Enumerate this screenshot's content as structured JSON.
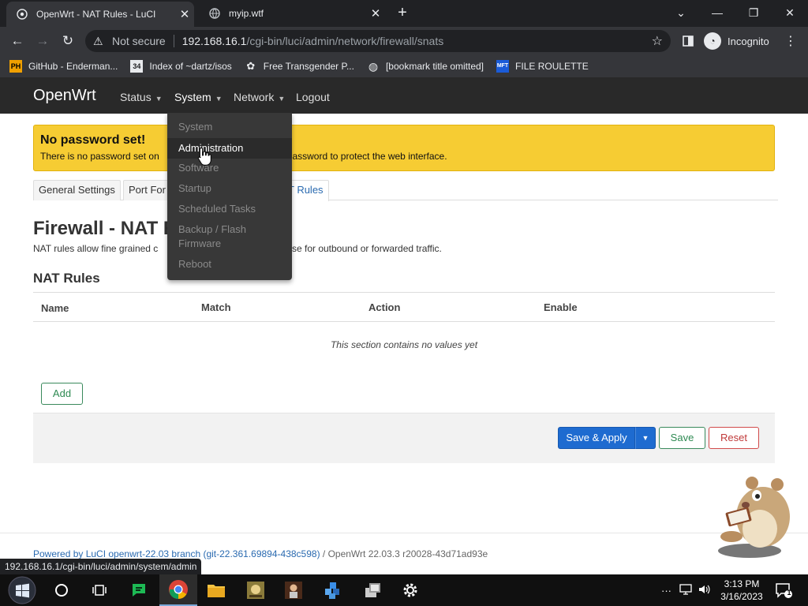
{
  "browser": {
    "tabs": [
      {
        "title": "OpenWrt - NAT Rules - LuCI",
        "active": true
      },
      {
        "title": "myip.wtf",
        "active": false
      }
    ],
    "new_tab_icon": "plus-icon",
    "window_controls": {
      "minimize": "chevron-down",
      "restore": "restore",
      "close": "close"
    },
    "nav": {
      "back": "←",
      "forward": "→",
      "reload": "↻"
    },
    "url": {
      "security_label": "Not secure",
      "host": "192.168.16.1",
      "path": "/cgi-bin/luci/admin/network/firewall/snats"
    },
    "incognito_label": "Incognito",
    "bookmarks": [
      {
        "icon": "PH",
        "label": "GitHub - Enderman..."
      },
      {
        "icon": "34",
        "label": "Index of ~dartz/isos"
      },
      {
        "icon": "✿",
        "label": "Free Transgender P..."
      },
      {
        "icon": "◍",
        "label": "[bookmark title omitted]"
      },
      {
        "icon": "MFT",
        "label": "FILE ROULETTE"
      }
    ],
    "status_url": "192.168.16.1/cgi-bin/luci/admin/system/admin"
  },
  "openwrt": {
    "brand": "OpenWrt",
    "menu": [
      {
        "label": "Status",
        "caret": true
      },
      {
        "label": "System",
        "caret": true
      },
      {
        "label": "Network",
        "caret": true
      },
      {
        "label": "Logout",
        "caret": false
      }
    ],
    "system_dropdown": [
      {
        "label": "System"
      },
      {
        "label": "Administration",
        "hover": true
      },
      {
        "label": "Software"
      },
      {
        "label": "Startup"
      },
      {
        "label": "Scheduled Tasks"
      },
      {
        "label": "Backup / Flash Firmware"
      },
      {
        "label": "Reboot"
      }
    ],
    "alert": {
      "title": "No password set!",
      "text_left": "There is no password set on",
      "text_right": "e a root password to protect the web interface."
    },
    "tabs": [
      {
        "label": "General Settings"
      },
      {
        "label": "Port For"
      },
      {
        "label": "T Rules",
        "active": true
      }
    ],
    "page_title": "Firewall - NAT R",
    "page_desc_left": "NAT rules allow fine grained c",
    "page_desc_right": "use for outbound or forwarded traffic.",
    "section_title": "NAT Rules",
    "table": {
      "columns": [
        "Name",
        "Match",
        "Action",
        "Enable"
      ],
      "empty_text": "This section contains no values yet"
    },
    "buttons": {
      "add": "Add",
      "save_apply": "Save & Apply",
      "save": "Save",
      "reset": "Reset"
    },
    "footer": {
      "link": "Powered by LuCI openwrt-22.03 branch (git-22.361.69894-438c598)",
      "rest": " / OpenWrt 22.03.3 r20028-43d71ad93e"
    }
  },
  "taskbar": {
    "clock_time": "3:13 PM",
    "clock_date": "3/16/2023",
    "notification_count": "1"
  },
  "colors": {
    "alert_bg": "#f6cc33",
    "header_bg": "#292929",
    "primary_blue": "#1e6bd0",
    "positive_green": "#2e8a52",
    "negative_red": "#c03a3a"
  }
}
